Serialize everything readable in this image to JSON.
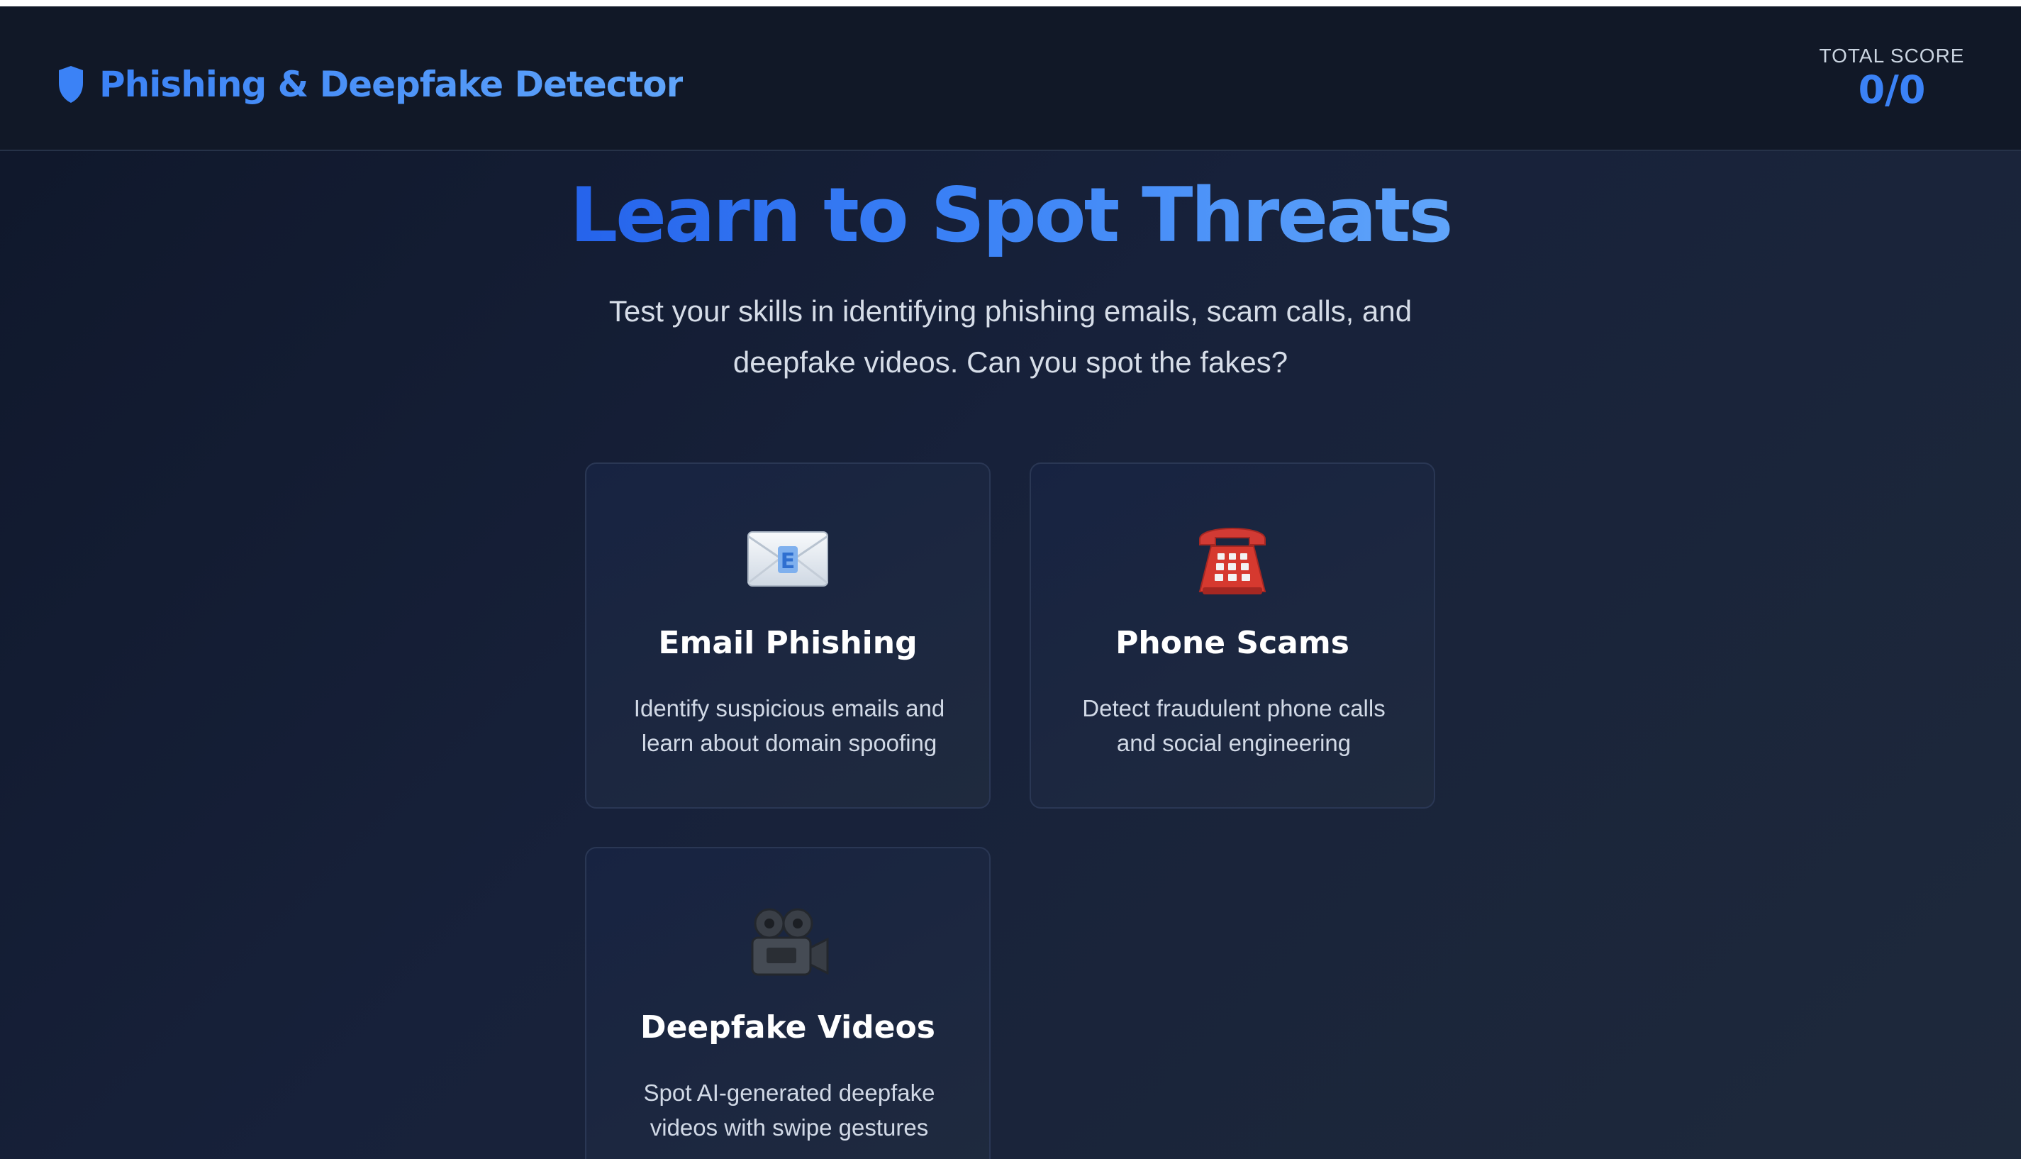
{
  "header": {
    "app_title": "Phishing & Deepfake Detector",
    "logo_icon": "shield-icon",
    "score_label": "TOTAL SCORE",
    "score_value": "0/0"
  },
  "hero": {
    "title": "Learn to Spot Threats",
    "subtitle": "Test your skills in identifying phishing emails, scam calls, and deepfake videos. Can you spot the fakes?"
  },
  "cards": [
    {
      "icon": "envelope-icon",
      "title": "Email Phishing",
      "description": "Identify suspicious emails and learn about domain spoofing"
    },
    {
      "icon": "telephone-icon",
      "title": "Phone Scams",
      "description": "Detect fraudulent phone calls and social engineering"
    },
    {
      "icon": "movie-camera-icon",
      "title": "Deepfake Videos",
      "description": "Spot AI-generated deepfake videos with swipe gestures"
    }
  ],
  "colors": {
    "accent": "#3b82f6",
    "accent_light": "#60a5fa",
    "background": "#0f172a",
    "card_border": "#2a3754"
  }
}
